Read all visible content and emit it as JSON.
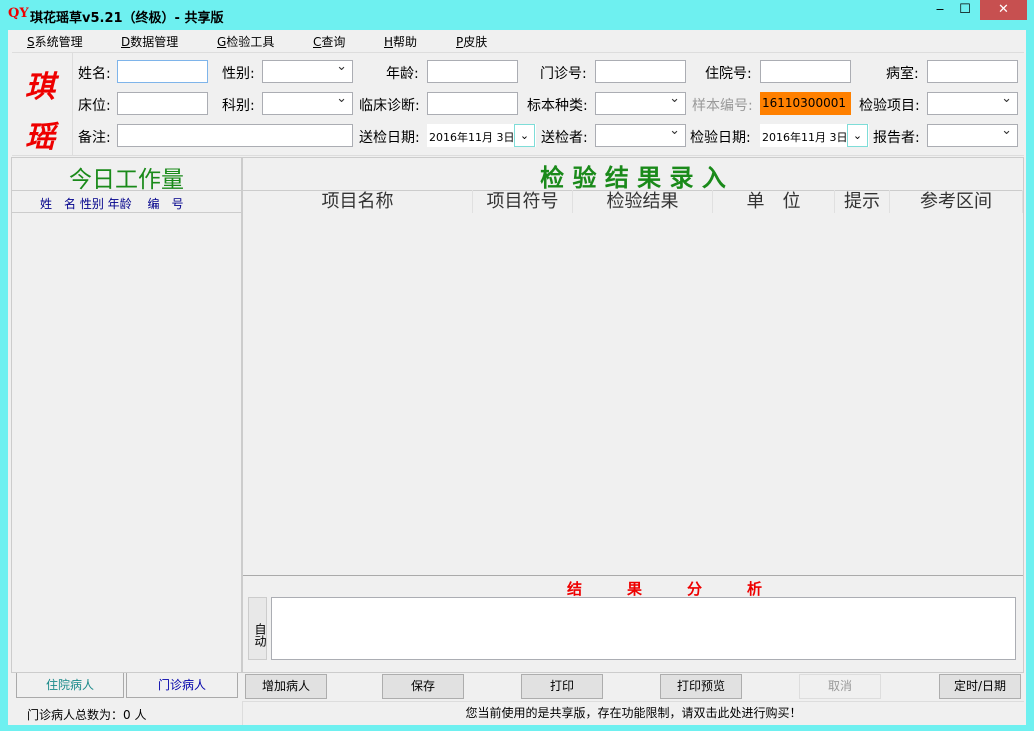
{
  "window": {
    "title": "琪花瑶草v5.21（终极）- 共享版",
    "logo": "QY",
    "minimize": "‒",
    "maximize": "☐",
    "close": "✕"
  },
  "menu": [
    {
      "key": "S",
      "label": "系统管理"
    },
    {
      "key": "D",
      "label": "数据管理"
    },
    {
      "key": "G",
      "label": "检验工具"
    },
    {
      "key": "C",
      "label": "查询"
    },
    {
      "key": "H",
      "label": "帮助"
    },
    {
      "key": "P",
      "label": "皮肤"
    }
  ],
  "brand": {
    "char1": "琪",
    "char2": "瑶"
  },
  "form": {
    "name": "姓名:",
    "sex": "性别:",
    "age": "年龄:",
    "outpatient_no": "门诊号:",
    "inpatient_no": "住院号:",
    "ward": "病室:",
    "bed": "床位:",
    "department": "科别:",
    "diagnosis": "临床诊断:",
    "specimen_type": "标本种类:",
    "sample_no": "样本编号:",
    "sample_no_value": "16110300001",
    "test_item": "检验项目:",
    "remark": "备注:",
    "send_date": "送检日期:",
    "send_date_value": "2016年11月 3日",
    "sender": "送检者:",
    "test_date": "检验日期:",
    "test_date_value": "2016年11月 3日",
    "reporter": "报告者:"
  },
  "left": {
    "title": "今日工作量",
    "header": "姓　名 性别 年龄　 编　号",
    "tabs": [
      "住院病人",
      "门诊病人"
    ],
    "status": "门诊病人总数为：0 人"
  },
  "main": {
    "title": "检 验 结 果 录 入",
    "columns": [
      "项目名称",
      "项目符号",
      "检验结果",
      "单　位",
      "提示",
      "参考区间"
    ],
    "analysis_title": "结　　　果　　　分　　　析",
    "auto": "自动"
  },
  "buttons": [
    "增加病人",
    "保存",
    "打印",
    "打印预览",
    "取消",
    "定时/日期"
  ],
  "status": "您当前使用的是共享版，存在功能限制，请双击此处进行购买！",
  "colors": {
    "accent": "#6ef0f0",
    "sample_bg": "#ff8000",
    "green": "#1a8a1a",
    "red": "#e00000"
  }
}
